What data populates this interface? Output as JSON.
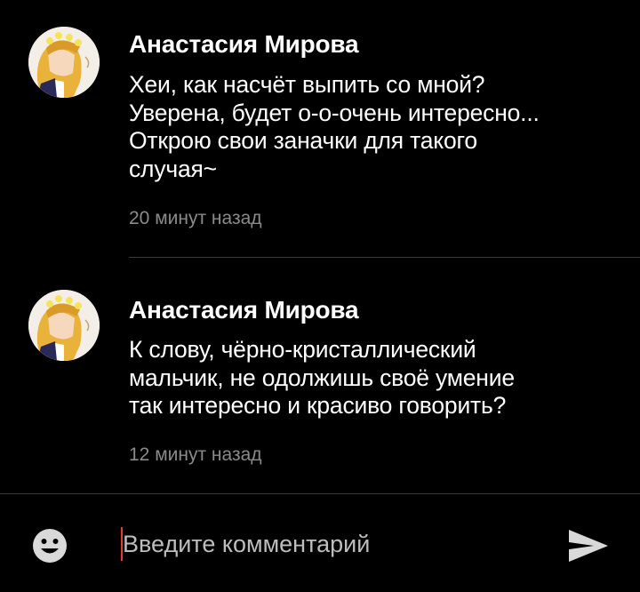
{
  "comments": [
    {
      "author": "Анастасия Мирова",
      "lines": [
        "Хеи, как насчёт выпить со мной?",
        "Уверена, будет о-о-очень интересно...",
        "Открою свои заначки для такого",
        "случая~"
      ],
      "time": "20 минут назад"
    },
    {
      "author": "Анастасия Мирова",
      "lines": [
        "К слову, чёрно-кристаллический",
        "мальчик, не одолжишь своё умение",
        "так интересно и красиво говорить?"
      ],
      "time": "12 минут назад"
    }
  ],
  "composer": {
    "placeholder": "Введите комментарий",
    "value": ""
  },
  "icons": {
    "emoji": "smiley-face-icon",
    "send": "send-arrow-icon"
  },
  "colors": {
    "background": "#000000",
    "text": "#ffffff",
    "meta": "#8a8a8a",
    "caret": "#e53935",
    "icon": "#d9d9d9"
  }
}
